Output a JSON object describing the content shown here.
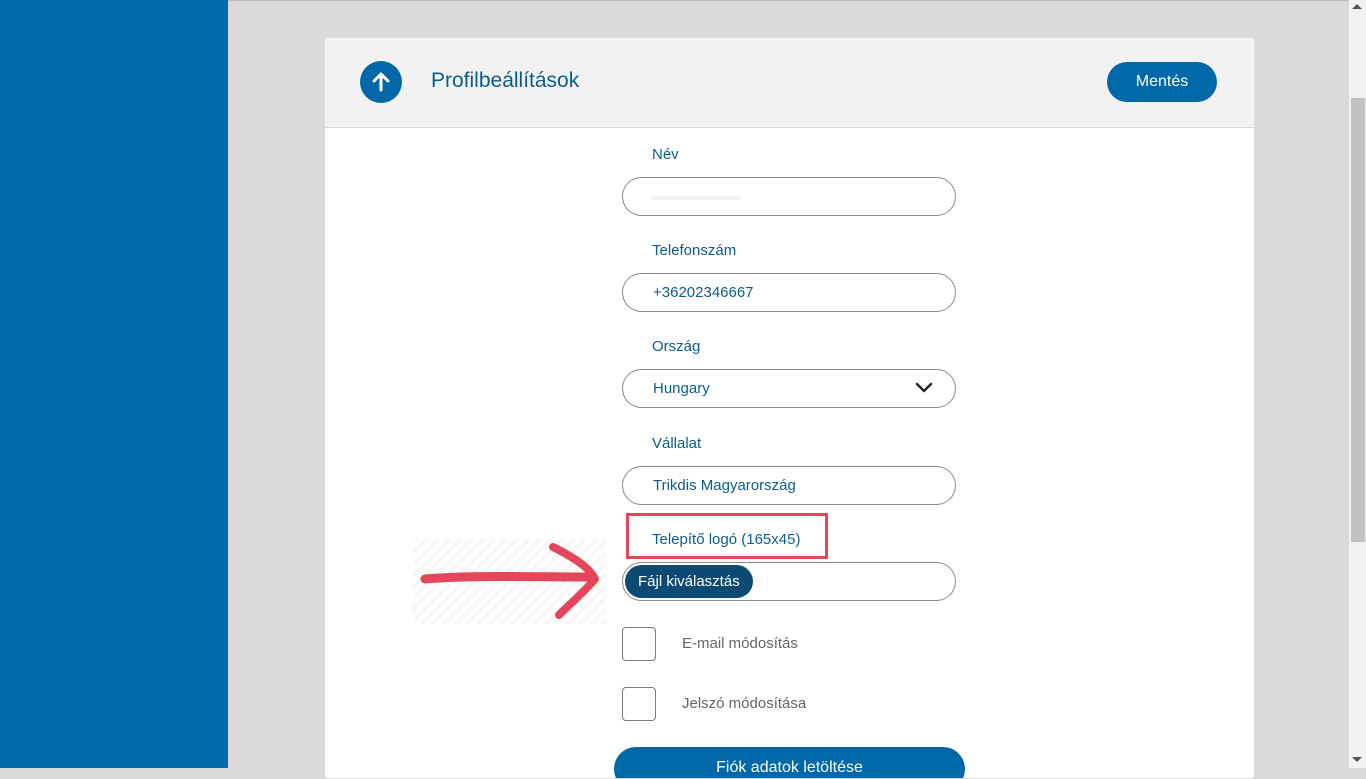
{
  "header": {
    "title": "Profilbeállítások",
    "save_label": "Mentés"
  },
  "form": {
    "name": {
      "label": "Név",
      "value": ""
    },
    "phone": {
      "label": "Telefonszám",
      "value": "+36202346667"
    },
    "country": {
      "label": "Ország",
      "value": "Hungary"
    },
    "company": {
      "label": "Vállalat",
      "value": "Trikdis Magyarország"
    },
    "logo": {
      "label": "Telepítő logó (165x45)",
      "button_label": "Fájl kiválasztás"
    },
    "email_change": {
      "label": "E-mail módosítás",
      "checked": false
    },
    "password_change": {
      "label": "Jelszó módosítása",
      "checked": false
    },
    "download_label": "Fiók adatok letöltése"
  },
  "colors": {
    "primary": "#0068a8",
    "text": "#0a5d8e",
    "annotation": "#e4475b",
    "file_button": "#0a4a73"
  }
}
